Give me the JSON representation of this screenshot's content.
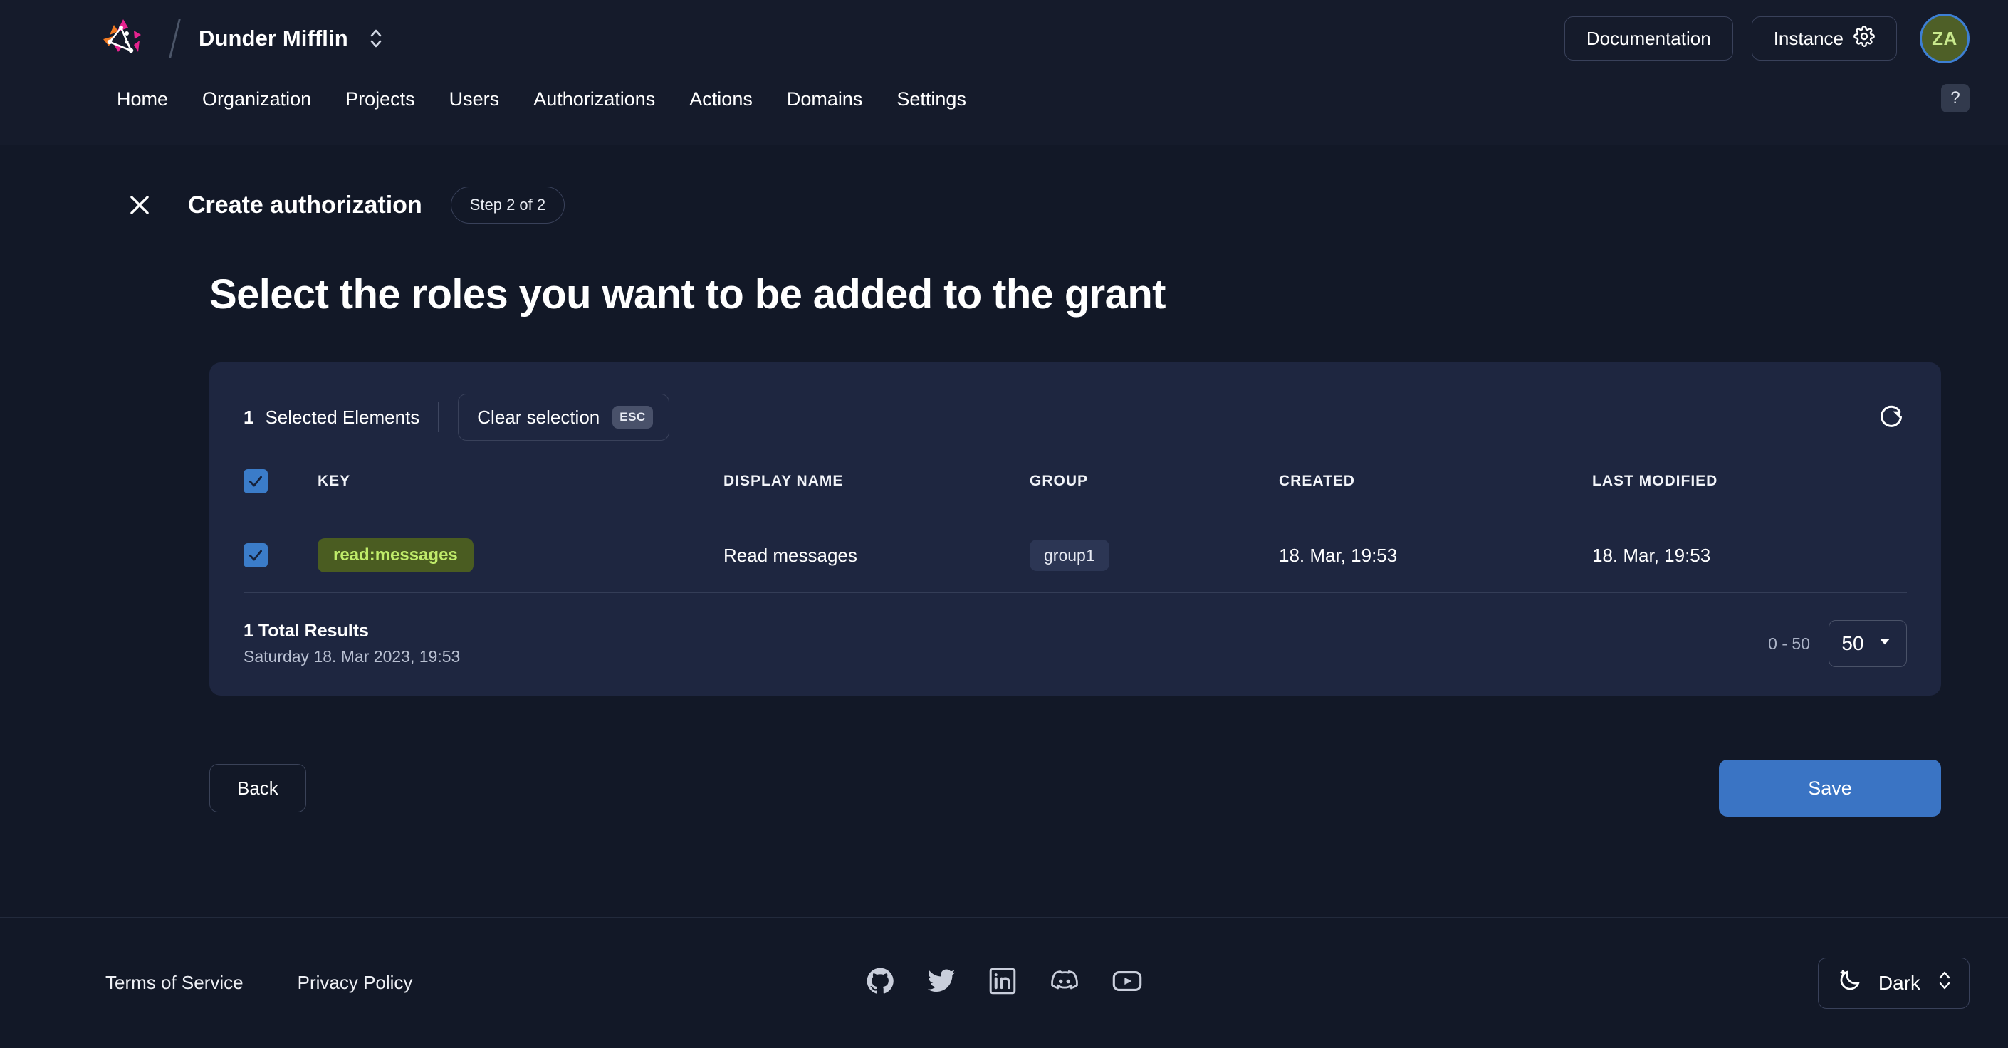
{
  "header": {
    "logo_icon": "zitadel-logo-icon",
    "org_name": "Dunder Mifflin",
    "org_switch_icon": "chevron-up-down-icon",
    "documentation_label": "Documentation",
    "instance_label": "Instance",
    "instance_icon": "gear-icon",
    "avatar_initials": "ZA"
  },
  "nav": {
    "items": [
      {
        "label": "Home",
        "name": "nav-home"
      },
      {
        "label": "Organization",
        "name": "nav-organization"
      },
      {
        "label": "Projects",
        "name": "nav-projects"
      },
      {
        "label": "Users",
        "name": "nav-users"
      },
      {
        "label": "Authorizations",
        "name": "nav-authorizations"
      },
      {
        "label": "Actions",
        "name": "nav-actions"
      },
      {
        "label": "Domains",
        "name": "nav-domains"
      },
      {
        "label": "Settings",
        "name": "nav-settings"
      }
    ],
    "help_label": "?"
  },
  "wizard": {
    "close_icon": "close-icon",
    "title": "Create authorization",
    "step": "Step 2 of 2",
    "headline": "Select the roles you want to be added to the grant"
  },
  "table_card": {
    "selected_count": "1",
    "selected_label": "Selected Elements",
    "clear_selection_label": "Clear selection",
    "clear_selection_key": "ESC",
    "refresh_icon": "refresh-icon",
    "columns": [
      "KEY",
      "DISPLAY NAME",
      "GROUP",
      "CREATED",
      "LAST MODIFIED"
    ],
    "rows": [
      {
        "selected": true,
        "key": "read:messages",
        "display_name": "Read messages",
        "group": "group1",
        "created": "18. Mar, 19:53",
        "last_modified": "18. Mar, 19:53"
      }
    ],
    "total_results": "1 Total Results",
    "total_timestamp": "Saturday 18. Mar 2023, 19:53",
    "range": "0 - 50",
    "page_size": "50",
    "page_size_icon": "chevron-down-icon"
  },
  "actions": {
    "back_label": "Back",
    "save_label": "Save"
  },
  "footer": {
    "links": [
      {
        "label": "Terms of Service",
        "name": "footer-terms-of-service"
      },
      {
        "label": "Privacy Policy",
        "name": "footer-privacy-policy"
      }
    ],
    "socials": [
      "github-icon",
      "twitter-icon",
      "linkedin-icon",
      "discord-icon",
      "youtube-icon"
    ],
    "theme_label": "Dark",
    "theme_icon": "moon-icon",
    "theme_switch_icon": "chevron-up-down-icon"
  },
  "colors": {
    "page_bg": "#121827",
    "panel_bg": "#151b2b",
    "card_bg": "#1e2640",
    "accent_blue": "#3a74c4",
    "checkbox_blue": "#3b7cc9",
    "chip_key_bg": "#4a5c21",
    "chip_key_text": "#c0ec6a",
    "chip_group_bg": "#2c3654",
    "avatar_bg": "#4e5f27",
    "avatar_text": "#c8e88c"
  }
}
